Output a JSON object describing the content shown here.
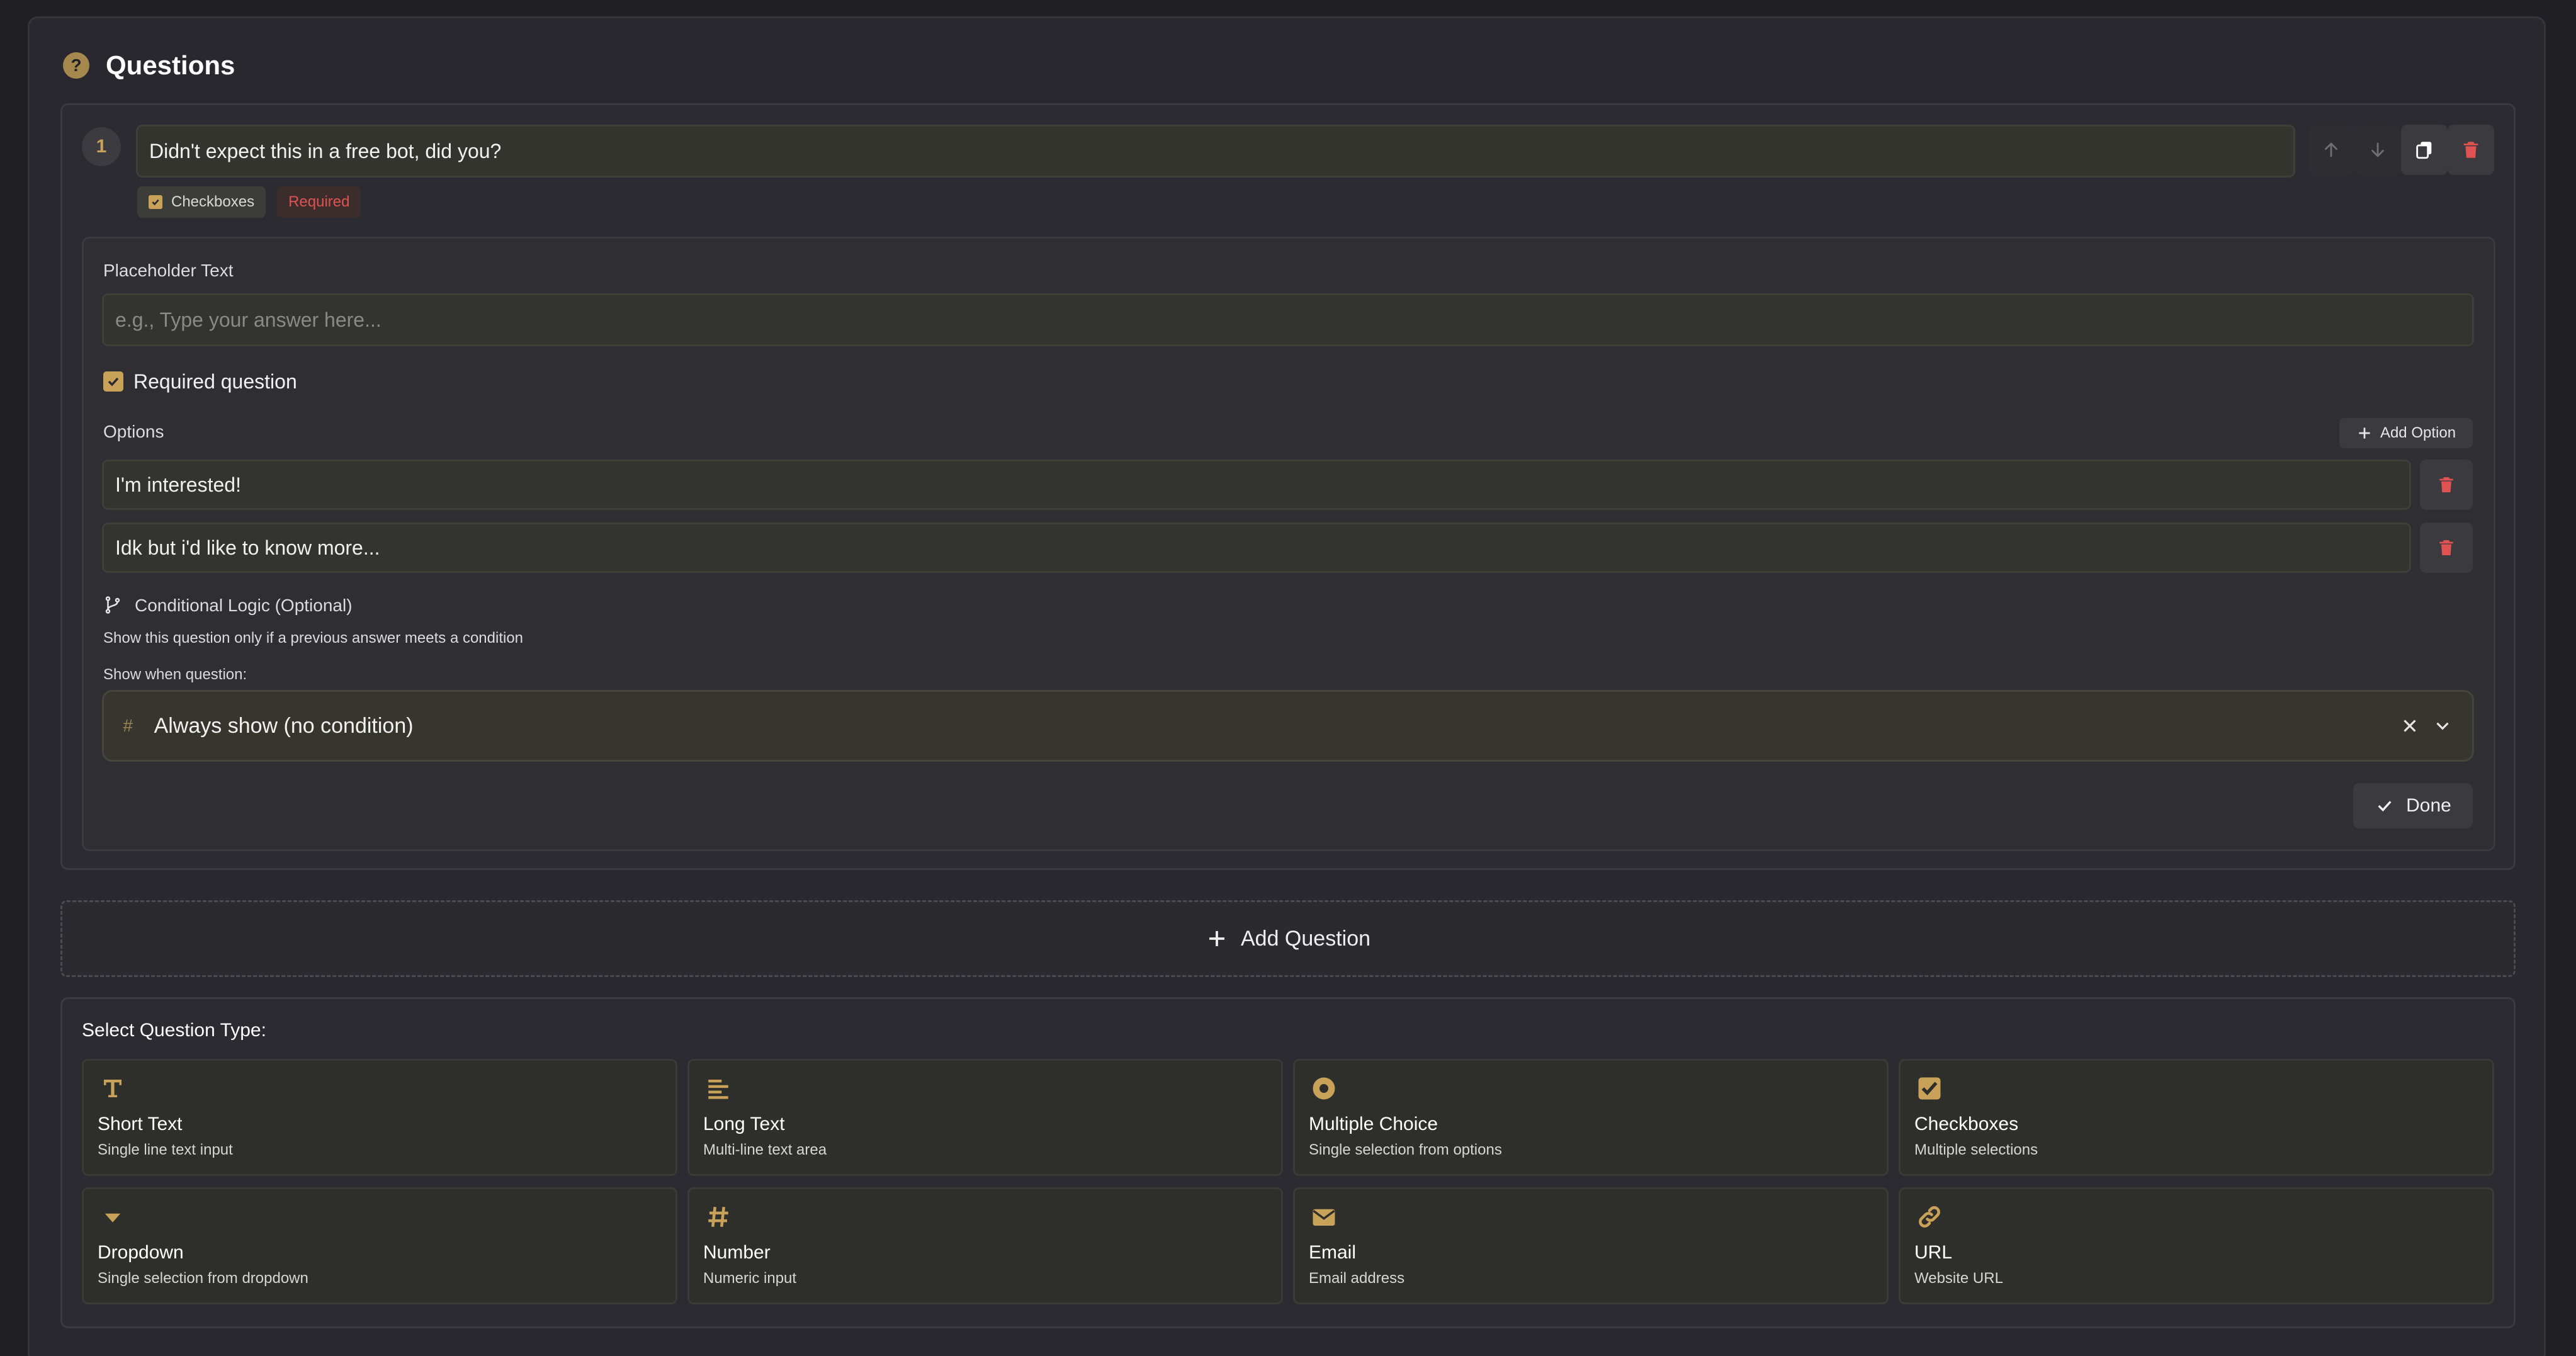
{
  "colors": {
    "accent": "#c9a25a",
    "danger": "#e05252",
    "background": "#1f1f24",
    "panel": "#28282e"
  },
  "header": {
    "title": "Questions",
    "icon": "help-icon"
  },
  "question": {
    "number": "1",
    "title": "Didn't expect this in a free bot, did you?",
    "type_tag": "Checkboxes",
    "required_tag": "Required",
    "actions": [
      "arrow-up-icon",
      "arrow-down-icon",
      "copy-icon",
      "trash-icon"
    ]
  },
  "editor": {
    "placeholder_label": "Placeholder Text",
    "placeholder_input_placeholder": "e.g., Type your answer here...",
    "required_label": "Required question",
    "required_checked": true,
    "options_label": "Options",
    "add_option_label": "Add Option",
    "options": [
      "I'm interested!",
      "Idk but i'd like to know more..."
    ],
    "conditional_title": "Conditional Logic (Optional)",
    "conditional_desc": "Show this question only if a previous answer meets a condition",
    "show_when_label": "Show when question:",
    "show_when_value": "Always show (no condition)",
    "done_label": "Done"
  },
  "add_question_label": "Add Question",
  "types_section": {
    "title": "Select Question Type:",
    "types": [
      {
        "name": "Short Text",
        "desc": "Single line text input",
        "icon": "text-icon"
      },
      {
        "name": "Long Text",
        "desc": "Multi-line text area",
        "icon": "paragraph-icon"
      },
      {
        "name": "Multiple Choice",
        "desc": "Single selection from options",
        "icon": "radio-icon"
      },
      {
        "name": "Checkboxes",
        "desc": "Multiple selections",
        "icon": "checkbox-icon"
      },
      {
        "name": "Dropdown",
        "desc": "Single selection from dropdown",
        "icon": "caret-down-icon"
      },
      {
        "name": "Number",
        "desc": "Numeric input",
        "icon": "hash-icon"
      },
      {
        "name": "Email",
        "desc": "Email address",
        "icon": "envelope-icon"
      },
      {
        "name": "URL",
        "desc": "Website URL",
        "icon": "link-icon"
      }
    ]
  }
}
